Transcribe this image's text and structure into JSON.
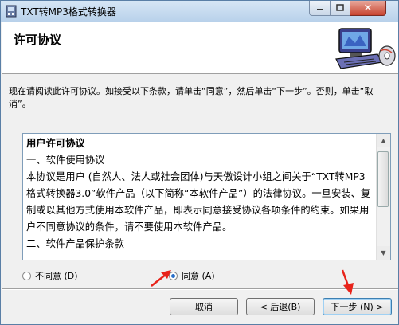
{
  "window": {
    "title": "TXT转MP3格式转换器",
    "close_glyph": "✕"
  },
  "header": {
    "title": "许可协议"
  },
  "description": "现在请阅读此许可协议。如接受以下条款，请单击“同意”，然后单击“下一步”。否则，单击“取消”。",
  "license": {
    "heading": "用户许可协议",
    "lines": [
      "一、软件使用协议",
      " 本协议是用户 (自然人、法人或社会团体)与天傲设计小组之间关于“TXT转MP3格式转换器3.0”软件产品（以下简称“本软件产品”）的法律协议。一旦安装、复制或以其他方式使用本软件产品，即表示同意接受协议各项条件的约束。如果用户不同意协议的条件，请不要使用本软件产品。",
      "二、软件产品保护条款"
    ]
  },
  "options": {
    "disagree": "不同意 (D)",
    "agree": "同意 (A)",
    "selected": "agree"
  },
  "buttons": {
    "cancel": "取消",
    "back": "< 后退(B)",
    "next": "下一步 (N) >"
  },
  "colors": {
    "annotation_arrow": "#e8231a"
  }
}
